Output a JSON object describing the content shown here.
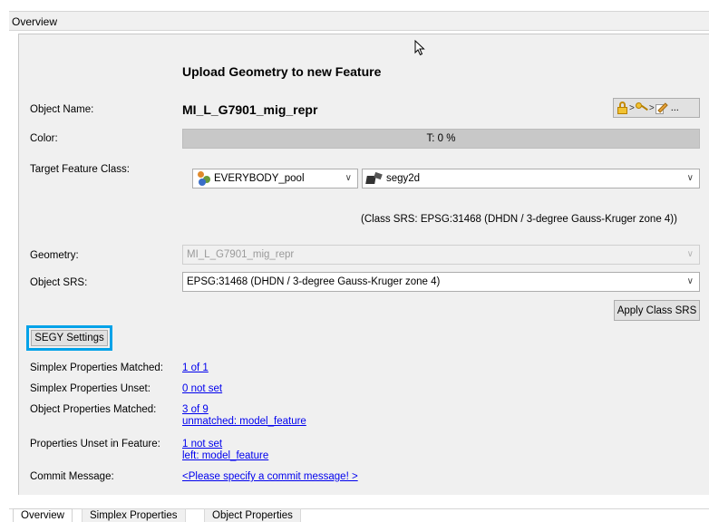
{
  "window": {
    "title": "Overview"
  },
  "form": {
    "heading": "Upload Geometry to new Feature",
    "object_name": {
      "label": "Object Name:",
      "value": "MI_L_G7901_mig_repr"
    },
    "color": {
      "label": "Color:",
      "progress_text": "T: 0 %",
      "progress": 0
    },
    "target_feature_class": {
      "label": "Target Feature Class:",
      "pool": "EVERYBODY_pool",
      "pool_icon": "pool-icon",
      "feature_class": "segy2d",
      "feature_class_icon": "seismic-icon"
    },
    "class_srs_note": "(Class SRS: EPSG:31468 (DHDN / 3-degree Gauss-Kruger zone 4))",
    "geometry": {
      "label": "Geometry:",
      "value": "MI_L_G7901_mig_repr"
    },
    "object_srs": {
      "label": "Object SRS:",
      "value": "EPSG:31468 (DHDN / 3-degree Gauss-Kruger zone 4)"
    },
    "apply_class_srs": "Apply Class SRS",
    "segy_settings": "SEGY Settings",
    "simplex_matched": {
      "label": "Simplex Properties Matched:",
      "value": "1 of 1"
    },
    "simplex_unset": {
      "label": "Simplex Properties Unset:",
      "value": "0 not set"
    },
    "object_matched": {
      "label": "Object Properties Matched:",
      "value": "3 of 9",
      "detail": "unmatched: model_feature"
    },
    "props_unset": {
      "label": "Properties Unset in Feature:",
      "value": "1 not set",
      "detail": "left: model_feature"
    },
    "commit": {
      "label": "Commit Message:",
      "value": "<Please specify a commit message! >"
    },
    "toolbar": {
      "more_label": "..."
    }
  },
  "tabs": [
    {
      "label": "Overview",
      "active": true
    },
    {
      "label": "Simplex Properties",
      "active": false
    },
    {
      "label": "Object Properties",
      "active": false
    }
  ],
  "colors": {
    "accent_highlight": "#00a2e8",
    "link": "#0000ee"
  }
}
